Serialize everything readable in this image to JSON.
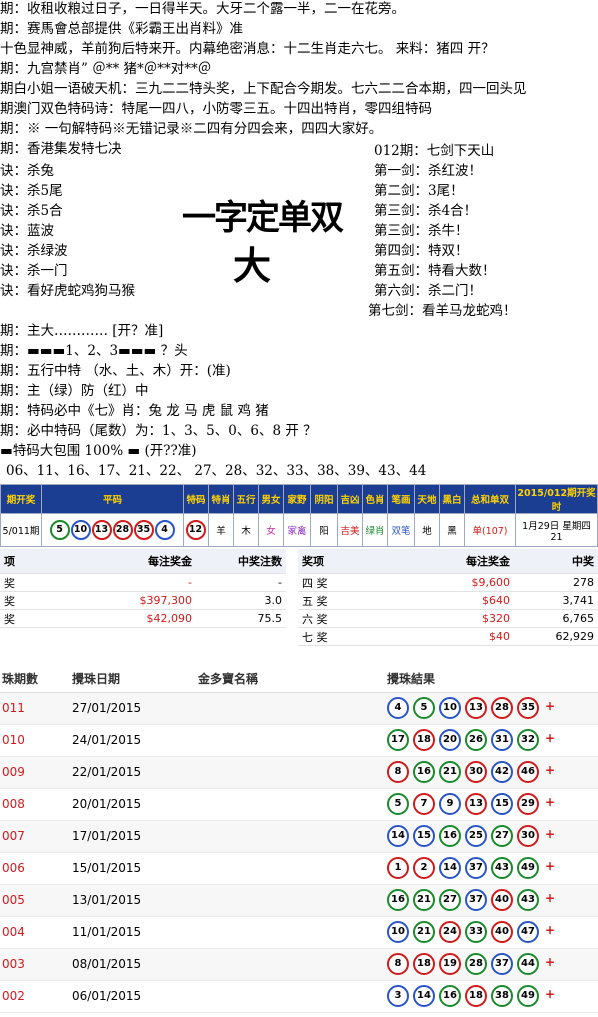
{
  "lines": [
    "期：收租收粮过日子，一日得半天。大牙二个露一半，二一在花旁。",
    "期：赛馬會总部提供《彩霸王出肖料》准",
    "十色显神威，羊前狗后特来开。内幕绝密消息：十二生肖走六七。 来料：猪四 开？",
    "期：九宫禁肖” ＠** 猪*＠**对**＠",
    "期白小姐一语破天机：三九二二特头奖，上下配合今期发。七六二二合本期，四一回头见",
    "期澳门双色特码诗：特尾一四八，小防零三五。十四出特肖，零四组特码",
    "期：※ 一句解特码※无错记录※二四有分四会来，四四大家好。",
    "期：香港集发特七决"
  ],
  "jue": [
    "诀：杀兔",
    "诀：杀5尾",
    "诀：杀5合",
    "诀：蓝波",
    "诀：杀绿波",
    "诀：杀一门",
    "诀：看好虎蛇鸡狗马猴"
  ],
  "big_text": {
    "line1": "一字定单双",
    "line2": "大"
  },
  "sword": [
    "012期：七剑下天山",
    "第一剑：杀红波！",
    "第二剑：3尾！",
    "第三剑：杀4合！",
    "第三剑：杀牛！",
    "第四剑：特双！",
    "第五剑：特看大数！",
    "第六剑：杀二门！",
    "第七剑：看羊马龙蛇鸡！"
  ],
  "lines2": [
    "期：主大………… [开？准]",
    "期：▬▬▬1、2、3▬▬▬ ？头",
    "期：五行中特 （水、土、木）开：(准)",
    "期：主（绿）防（红）中",
    "期：特码必中《七》肖：兔 龙 马 虎 鼠 鸡 猪",
    "期：必中特码（尾数）为：1、3、5、0、6、8 开 ？",
    "▬特码大包围 100% ▬ (开??准)",
    "06、11、16、17、21、22、 27、28、32、33、38、39、43、44"
  ],
  "draw": {
    "headers": [
      "期开奖",
      "平码",
      "特码",
      "特肖",
      "五行",
      "男女",
      "家野",
      "阴阳",
      "吉凶",
      "色肖",
      "笔画",
      "天地",
      "黑白",
      "总和单双",
      "2015/012期开奖时"
    ],
    "period": "5/011期",
    "balls": [
      "5",
      "10",
      "13",
      "28",
      "35",
      "4"
    ],
    "special": "12",
    "values": [
      "羊",
      "木",
      "女",
      "家禽",
      "阳",
      "吉美",
      "绿肖",
      "双笔",
      "地",
      "黑",
      "单(107)",
      "1月29日 星期四 21"
    ]
  },
  "prize_left": {
    "headers": [
      "项",
      "每注奖金",
      "中奖注数"
    ],
    "rows": [
      [
        "奖",
        "-",
        "-"
      ],
      [
        "奖",
        "$397,300",
        "3.0"
      ],
      [
        "奖",
        "$42,090",
        "75.5"
      ]
    ]
  },
  "prize_right": {
    "headers": [
      "奖项",
      "每注奖金",
      "中奖"
    ],
    "rows": [
      [
        "四 奖",
        "$9,600",
        "278"
      ],
      [
        "五 奖",
        "$640",
        "3,741"
      ],
      [
        "六 奖",
        "$320",
        "6,765"
      ],
      [
        "七 奖",
        "$40",
        "62,929"
      ]
    ]
  },
  "history": {
    "headers": [
      "珠期數",
      "攪珠日期",
      "金多寶名稱",
      "攪珠結果"
    ],
    "rows": [
      {
        "period": "011",
        "date": "27/01/2015",
        "balls": [
          "4",
          "5",
          "10",
          "13",
          "28",
          "35"
        ]
      },
      {
        "period": "010",
        "date": "24/01/2015",
        "balls": [
          "17",
          "18",
          "20",
          "26",
          "31",
          "32"
        ]
      },
      {
        "period": "009",
        "date": "22/01/2015",
        "balls": [
          "8",
          "16",
          "21",
          "30",
          "42",
          "46"
        ]
      },
      {
        "period": "008",
        "date": "20/01/2015",
        "balls": [
          "5",
          "7",
          "9",
          "13",
          "15",
          "29"
        ]
      },
      {
        "period": "007",
        "date": "17/01/2015",
        "balls": [
          "14",
          "15",
          "16",
          "25",
          "27",
          "30"
        ]
      },
      {
        "period": "006",
        "date": "15/01/2015",
        "balls": [
          "1",
          "2",
          "14",
          "37",
          "43",
          "49"
        ]
      },
      {
        "period": "005",
        "date": "13/01/2015",
        "balls": [
          "16",
          "21",
          "27",
          "37",
          "40",
          "43"
        ]
      },
      {
        "period": "004",
        "date": "11/01/2015",
        "balls": [
          "10",
          "21",
          "24",
          "33",
          "40",
          "47"
        ]
      },
      {
        "period": "003",
        "date": "08/01/2015",
        "balls": [
          "8",
          "18",
          "19",
          "28",
          "37",
          "44"
        ]
      },
      {
        "period": "002",
        "date": "06/01/2015",
        "balls": [
          "3",
          "14",
          "16",
          "18",
          "38",
          "49"
        ]
      }
    ],
    "plus": "+"
  },
  "colors": {
    "red": "#d21a1a",
    "blue": "#2a55c8",
    "green": "#1a8a2a",
    "header": "#1b3e93"
  }
}
